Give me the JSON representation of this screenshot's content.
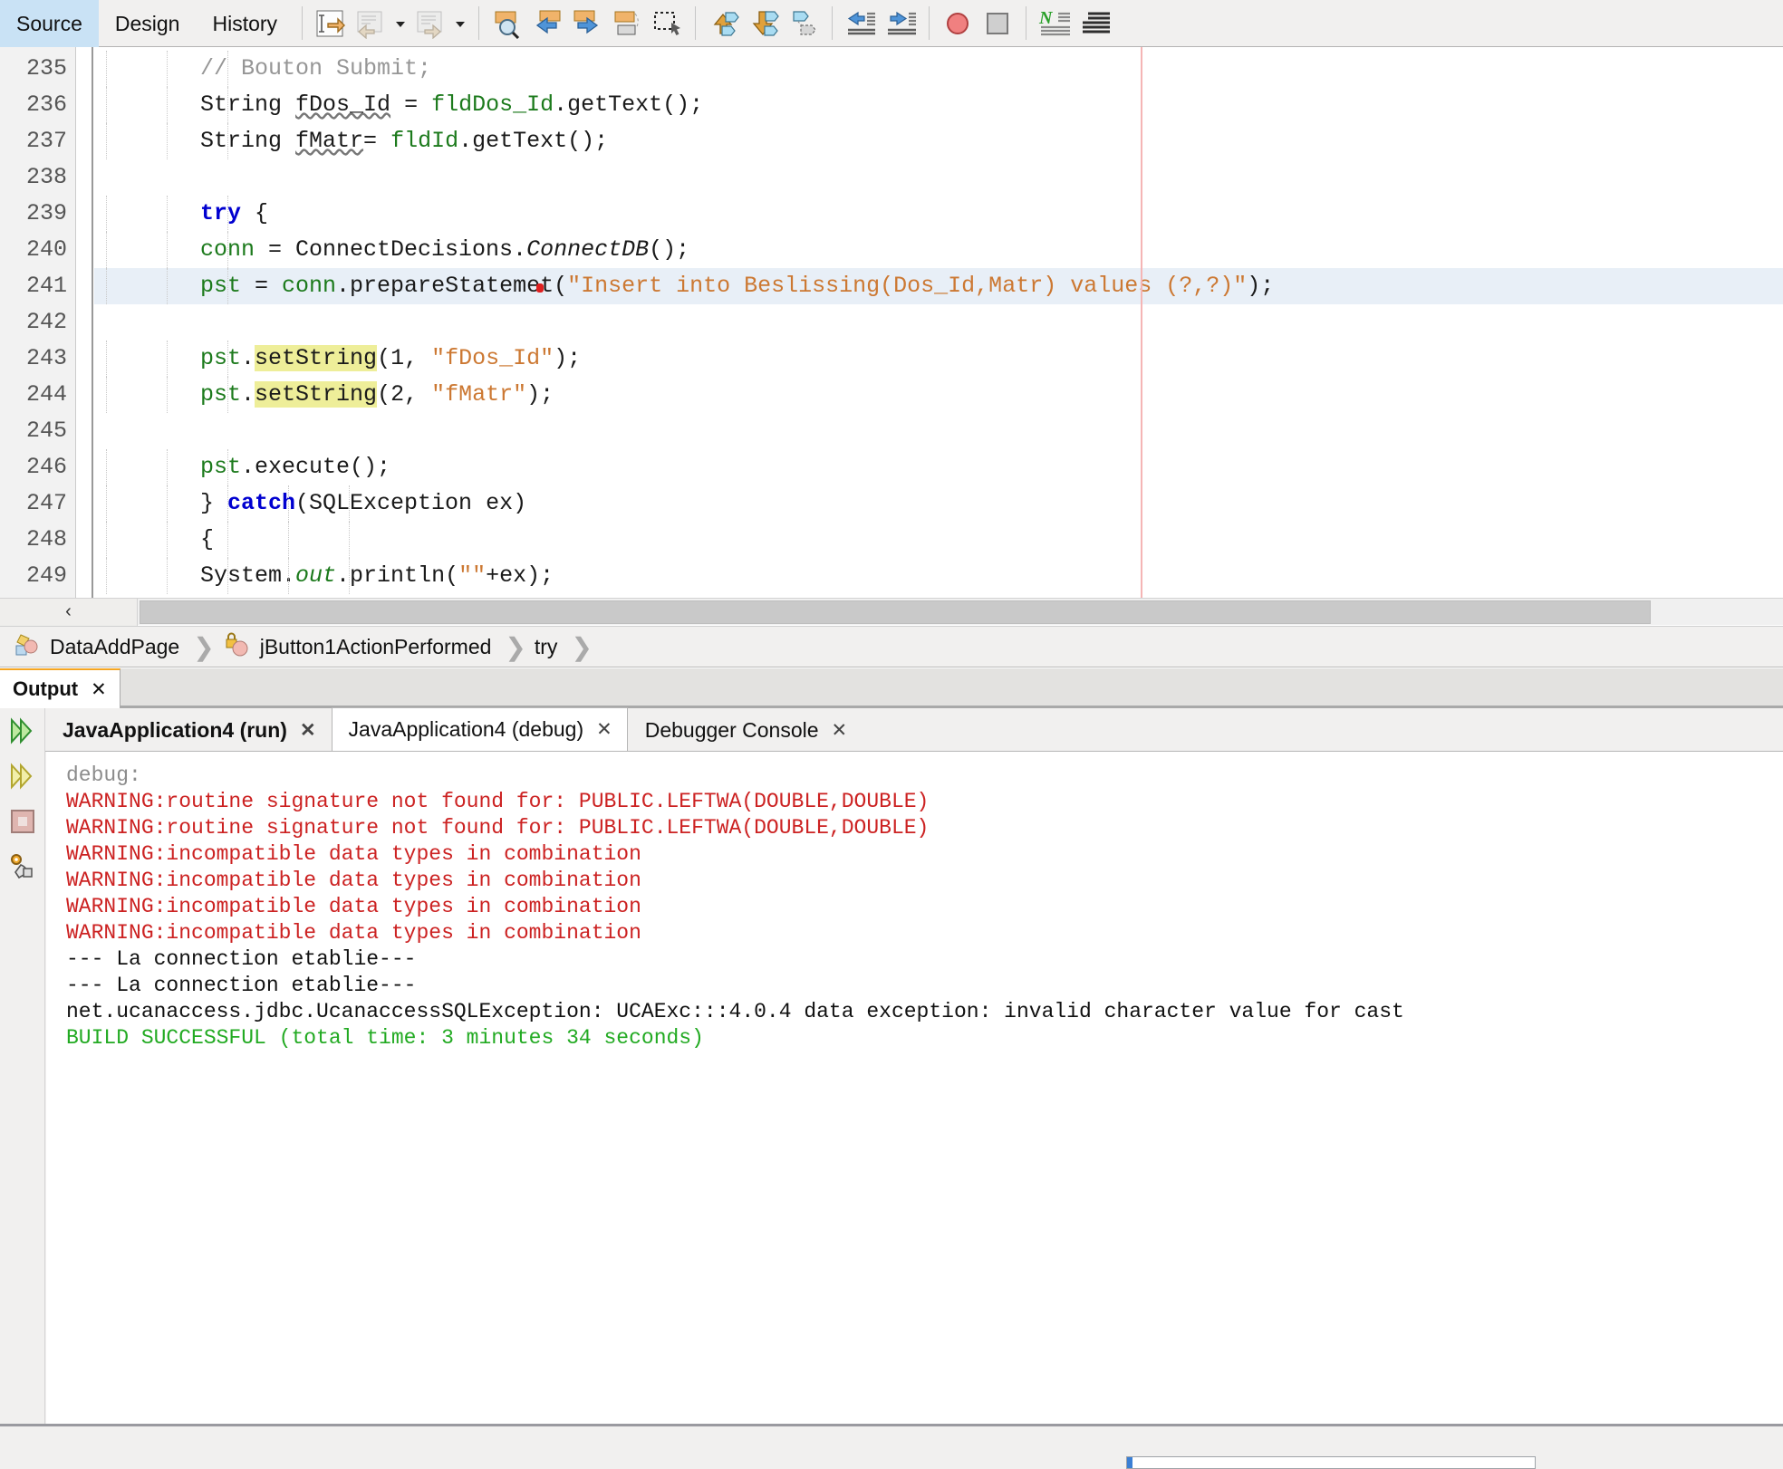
{
  "toolbar": {
    "view_tabs": [
      {
        "label": "Source",
        "active": true
      },
      {
        "label": "Design",
        "active": false
      },
      {
        "label": "History",
        "active": false
      }
    ],
    "buttons": [
      {
        "name": "last-edit-icon"
      },
      {
        "name": "back-icon"
      },
      {
        "name": "back-dropdown-icon"
      },
      {
        "name": "forward-icon"
      },
      {
        "name": "forward-dropdown-icon"
      },
      {
        "name": "find-selection-icon"
      },
      {
        "name": "previous-bookmark-icon"
      },
      {
        "name": "next-bookmark-icon"
      },
      {
        "name": "toggle-bookmark-icon"
      },
      {
        "name": "toggle-rectangular-selection-icon"
      },
      {
        "name": "previous-error-icon"
      },
      {
        "name": "next-error-icon"
      },
      {
        "name": "toggle-breakpoint-icon"
      },
      {
        "name": "shift-left-icon"
      },
      {
        "name": "shift-right-icon"
      },
      {
        "name": "stop-recording-icon"
      },
      {
        "name": "stop-macro-icon"
      },
      {
        "name": "start-macro-recording-icon"
      },
      {
        "name": "comment-icon"
      }
    ]
  },
  "editor": {
    "first_line": 235,
    "current_line": 241,
    "margin_column_color": "#f5b5b5",
    "lines": [
      {
        "num": 235,
        "indent": 3,
        "segments": [
          {
            "t": "// Bouton Submit;",
            "c": "tok-comment"
          }
        ]
      },
      {
        "num": 236,
        "indent": 3,
        "segments": [
          {
            "t": "String ",
            "c": "tok-plain"
          },
          {
            "t": "fDos_Id",
            "c": "tok-plain wavy"
          },
          {
            "t": " = ",
            "c": "tok-plain"
          },
          {
            "t": "fldDos_Id",
            "c": "tok-field"
          },
          {
            "t": ".getText();",
            "c": "tok-plain"
          }
        ]
      },
      {
        "num": 237,
        "indent": 3,
        "segments": [
          {
            "t": "String ",
            "c": "tok-plain"
          },
          {
            "t": "fMatr",
            "c": "tok-plain wavy"
          },
          {
            "t": "= ",
            "c": "tok-plain"
          },
          {
            "t": "fldId",
            "c": "tok-field"
          },
          {
            "t": ".getText();",
            "c": "tok-plain"
          }
        ]
      },
      {
        "num": 238,
        "indent": 0,
        "segments": []
      },
      {
        "num": 239,
        "indent": 3,
        "segments": [
          {
            "t": "try",
            "c": "tok-keyword"
          },
          {
            "t": " {",
            "c": "tok-plain"
          }
        ]
      },
      {
        "num": 240,
        "indent": 3,
        "segments": [
          {
            "t": "conn",
            "c": "tok-field"
          },
          {
            "t": " = ConnectDecisions.",
            "c": "tok-plain"
          },
          {
            "t": "ConnectDB",
            "c": "tok-staticm"
          },
          {
            "t": "();",
            "c": "tok-plain"
          }
        ]
      },
      {
        "num": 241,
        "indent": 3,
        "current": true,
        "segments": [
          {
            "t": "pst",
            "c": "tok-field"
          },
          {
            "t": " = ",
            "c": "tok-plain"
          },
          {
            "t": "conn",
            "c": "tok-field"
          },
          {
            "t": ".prepareStateme",
            "c": "tok-plain"
          },
          {
            "t": "●",
            "c": "caret-dot"
          },
          {
            "t": "t(",
            "c": "tok-plain"
          },
          {
            "t": "\"Insert into Beslissing(Dos_Id,Matr) values (?,?)\"",
            "c": "tok-string"
          },
          {
            "t": ");",
            "c": "tok-plain"
          }
        ]
      },
      {
        "num": 242,
        "indent": 0,
        "segments": []
      },
      {
        "num": 243,
        "indent": 3,
        "segments": [
          {
            "t": "pst",
            "c": "tok-field"
          },
          {
            "t": ".",
            "c": "tok-plain"
          },
          {
            "t": "setString",
            "c": "tok-plain tok-mark"
          },
          {
            "t": "(1, ",
            "c": "tok-plain"
          },
          {
            "t": "\"fDos_Id\"",
            "c": "tok-string"
          },
          {
            "t": ");",
            "c": "tok-plain"
          }
        ]
      },
      {
        "num": 244,
        "indent": 3,
        "segments": [
          {
            "t": "pst",
            "c": "tok-field"
          },
          {
            "t": ".",
            "c": "tok-plain"
          },
          {
            "t": "setString",
            "c": "tok-plain tok-mark"
          },
          {
            "t": "(2, ",
            "c": "tok-plain"
          },
          {
            "t": "\"fMatr\"",
            "c": "tok-string"
          },
          {
            "t": ");",
            "c": "tok-plain"
          }
        ]
      },
      {
        "num": 245,
        "indent": 0,
        "segments": []
      },
      {
        "num": 246,
        "indent": 3,
        "segments": [
          {
            "t": "pst",
            "c": "tok-field"
          },
          {
            "t": ".execute();",
            "c": "tok-plain"
          }
        ]
      },
      {
        "num": 247,
        "indent": 5,
        "segments": [
          {
            "t": "} ",
            "c": "tok-plain"
          },
          {
            "t": "catch",
            "c": "tok-keyword"
          },
          {
            "t": "(SQLException ex)",
            "c": "tok-plain"
          }
        ]
      },
      {
        "num": 248,
        "indent": 5,
        "segments": [
          {
            "t": "{",
            "c": "tok-plain"
          }
        ]
      },
      {
        "num": 249,
        "indent": 6,
        "segments": [
          {
            "t": "System.",
            "c": "tok-plain"
          },
          {
            "t": "out",
            "c": "tok-static"
          },
          {
            "t": ".println(",
            "c": "tok-plain"
          },
          {
            "t": "\"\"",
            "c": "tok-string"
          },
          {
            "t": "+ex);",
            "c": "tok-plain"
          }
        ]
      }
    ],
    "scroll_left_label": "‹"
  },
  "breadcrumb": {
    "items": [
      {
        "label": "DataAddPage",
        "icon": "class-icon"
      },
      {
        "label": "jButton1ActionPerformed",
        "icon": "private-method-icon"
      },
      {
        "label": "try",
        "icon": "none"
      }
    ],
    "separator": "❯"
  },
  "output_window": {
    "title": "Output",
    "close_label": "✕",
    "side_buttons": [
      {
        "name": "rerun-icon"
      },
      {
        "name": "rerun-disabled-icon"
      },
      {
        "name": "stop-icon"
      },
      {
        "name": "settings-icon"
      }
    ],
    "tabs": [
      {
        "label": "JavaApplication4 (run)",
        "selected": false,
        "bold": true,
        "close": "✕"
      },
      {
        "label": "JavaApplication4 (debug)",
        "selected": true,
        "bold": false,
        "close": "✕"
      },
      {
        "label": "Debugger Console",
        "selected": false,
        "bold": false,
        "close": "✕"
      }
    ],
    "console_lines": [
      {
        "text": "debug:",
        "color": "c-gray"
      },
      {
        "text": "WARNING:routine signature not found for: PUBLIC.LEFTWA(DOUBLE,DOUBLE)",
        "color": "c-red"
      },
      {
        "text": "WARNING:routine signature not found for: PUBLIC.LEFTWA(DOUBLE,DOUBLE)",
        "color": "c-red"
      },
      {
        "text": "WARNING:incompatible data types in combination",
        "color": "c-red"
      },
      {
        "text": "WARNING:incompatible data types in combination",
        "color": "c-red"
      },
      {
        "text": "WARNING:incompatible data types in combination",
        "color": "c-red"
      },
      {
        "text": "WARNING:incompatible data types in combination",
        "color": "c-red"
      },
      {
        "text": "--- La connection etablie---",
        "color": "c-black"
      },
      {
        "text": "--- La connection etablie---",
        "color": "c-black"
      },
      {
        "text": "net.ucanaccess.jdbc.UcanaccessSQLException: UCAExc:::4.0.4 data exception: invalid character value for cast",
        "color": "c-black"
      },
      {
        "text": "BUILD SUCCESSFUL (total time: 3 minutes 34 seconds)",
        "color": "c-green"
      }
    ]
  },
  "colors": {
    "accent": "#c9e2f5",
    "current_line": "#e8eff7",
    "occurrence_highlight": "#eeee99",
    "string": "#cc7832",
    "keyword": "#0000d0",
    "field": "#1c7a1c",
    "error": "#cc2222",
    "success": "#22aa22"
  }
}
